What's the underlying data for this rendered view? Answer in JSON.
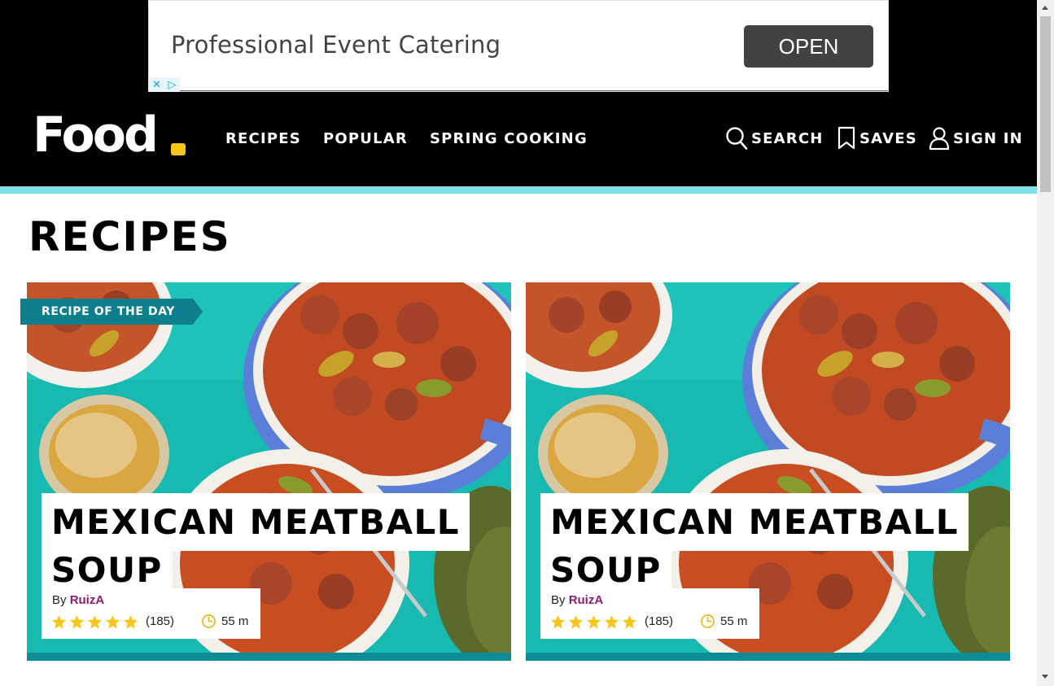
{
  "ad": {
    "headline": "Professional Event Catering",
    "button_label": "OPEN",
    "close_glyph": "✕",
    "adchoices_glyph": "▷"
  },
  "header": {
    "logo_text": "Food",
    "nav": [
      {
        "label": "RECIPES"
      },
      {
        "label": "POPULAR"
      },
      {
        "label": "SPRING COOKING"
      }
    ],
    "actions": {
      "search_label": "SEARCH",
      "saves_label": "SAVES",
      "signin_label": "SIGN IN"
    }
  },
  "page": {
    "title": "RECIPES"
  },
  "cards": [
    {
      "badge": "RECIPE OF THE DAY",
      "title_line1": "MEXICAN MEATBALL",
      "title_line2": "SOUP",
      "by": "By",
      "author": "RuizA",
      "stars": 5,
      "rating_count": "(185)",
      "time": "55 m"
    },
    {
      "title_line1": "MEXICAN MEATBALL",
      "title_line2": "SOUP",
      "by": "By",
      "author": "RuizA",
      "stars": 5,
      "rating_count": "(185)",
      "time": "55 m"
    }
  ],
  "colors": {
    "header_bg": "#000000",
    "accent_teal": "#7fdfe6",
    "logo_dot": "#f6c61b",
    "badge_bg": "#0e7f8c",
    "author_link": "#8b1c6f",
    "star": "#f6c61b"
  }
}
